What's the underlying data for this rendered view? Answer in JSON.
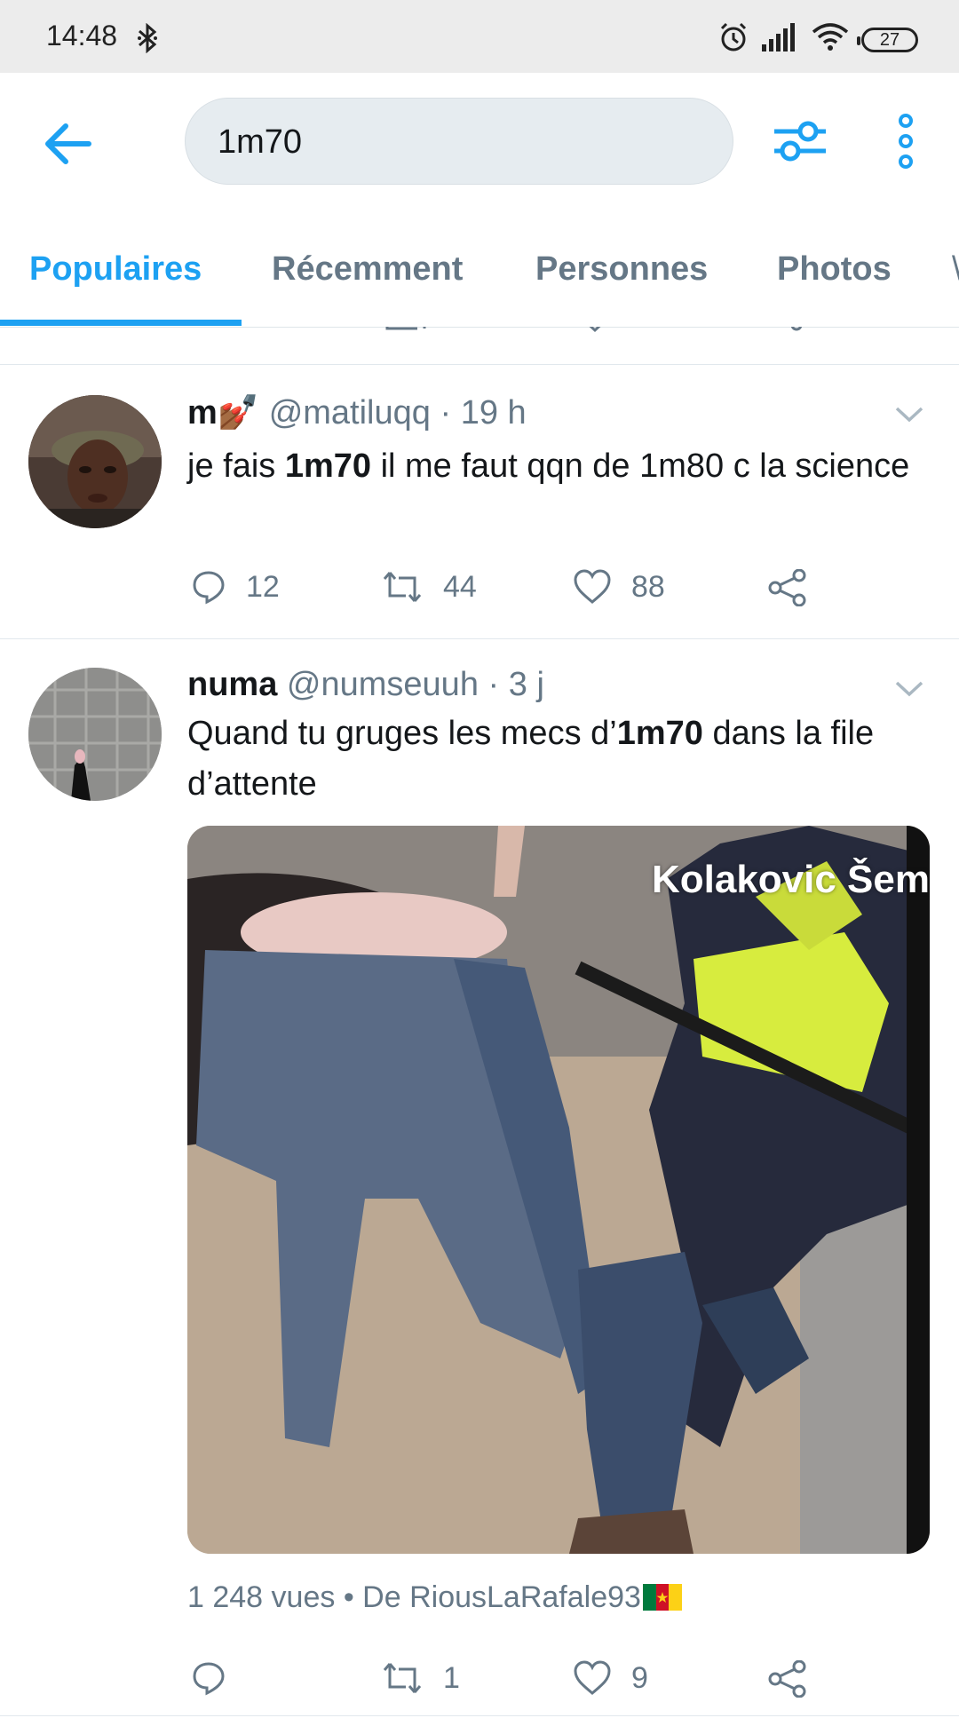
{
  "status_bar": {
    "time": "14:48",
    "battery": "27",
    "icons": [
      "bluetooth-icon",
      "alarm-icon",
      "signal-icon",
      "wifi-icon",
      "battery-icon"
    ]
  },
  "search": {
    "query": "1m70",
    "icons": [
      "back-arrow-icon",
      "filter-icon",
      "more-vertical-icon"
    ]
  },
  "tabs": [
    {
      "label": "Populaires",
      "active": true
    },
    {
      "label": "Récemment",
      "active": false
    },
    {
      "label": "Personnes",
      "active": false
    },
    {
      "label": "Photos",
      "active": false
    }
  ],
  "tweets": [
    {
      "display_name": "m",
      "name_emoji": "💅🏾",
      "handle": "@matiluqq",
      "time": "19 h",
      "text_before": "je fais ",
      "text_highlight": "1m70",
      "text_after": " il me faut qqn de 1m80 c la science",
      "replies": "12",
      "retweets": "44",
      "likes": "88"
    },
    {
      "display_name": "numa",
      "handle": "@numseuuh",
      "time": "3 j",
      "text_before": "Quand tu gruges les mecs d’",
      "text_highlight": "1m70",
      "text_after": " dans la file d’attente",
      "media_watermark": "Kolakovic Šem",
      "views": "1 248 vues",
      "source": "De RiousLaRafale93",
      "replies": "",
      "retweets": "1",
      "likes": "9"
    }
  ],
  "colors": {
    "accent": "#1da1f2",
    "secondary_text": "#657786",
    "primary_text": "#14171a",
    "search_bg": "#e6ecf0",
    "status_bar_bg": "#ececec"
  }
}
